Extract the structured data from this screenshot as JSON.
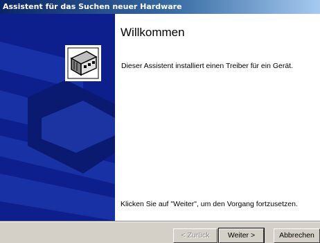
{
  "window": {
    "title": "Assistent für das Suchen neuer Hardware"
  },
  "colors": {
    "side_panel": "#0c1f8c",
    "title_start": "#0a246a",
    "title_end": "#a6caf0"
  },
  "content": {
    "heading": "Willkommen",
    "description": "Dieser Assistent installiert einen Treiber für ein Gerät.",
    "continue_hint": "Klicken Sie auf \"Weiter\", um den Vorgang fortzusetzen."
  },
  "buttons": {
    "back": "< Zurück",
    "next": "Weiter >",
    "cancel": "Abbrechen"
  },
  "icons": {
    "wizard": "hardware-card-icon"
  }
}
